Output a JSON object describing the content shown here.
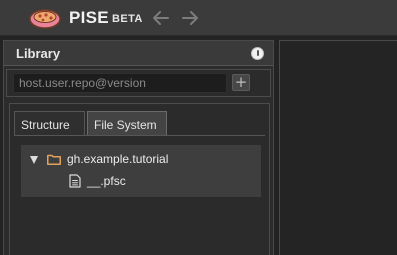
{
  "app": {
    "name": "PISE",
    "badge": "BETA",
    "logo_icon": "pise-logo-icon"
  },
  "nav": {
    "back_icon": "arrow-left-icon",
    "forward_icon": "arrow-right-icon"
  },
  "library": {
    "title": "Library",
    "info_icon": "info-icon",
    "search_placeholder": "host.user.repo@version",
    "search_value": "",
    "add_label": "+"
  },
  "tabs": [
    {
      "label": "Structure",
      "active": false
    },
    {
      "label": "File System",
      "active": true
    }
  ],
  "tree": {
    "root": {
      "label": "gh.example.tutorial",
      "icon": "folder-icon",
      "expanded": true
    },
    "children": [
      {
        "label": "__.pfsc",
        "icon": "file-icon"
      }
    ]
  },
  "colors": {
    "topbar_bg": "#3b3b3b",
    "panel_bg": "#2c2c2c",
    "folder_accent": "#e1a25c",
    "logo_pink": "#e9829a"
  }
}
